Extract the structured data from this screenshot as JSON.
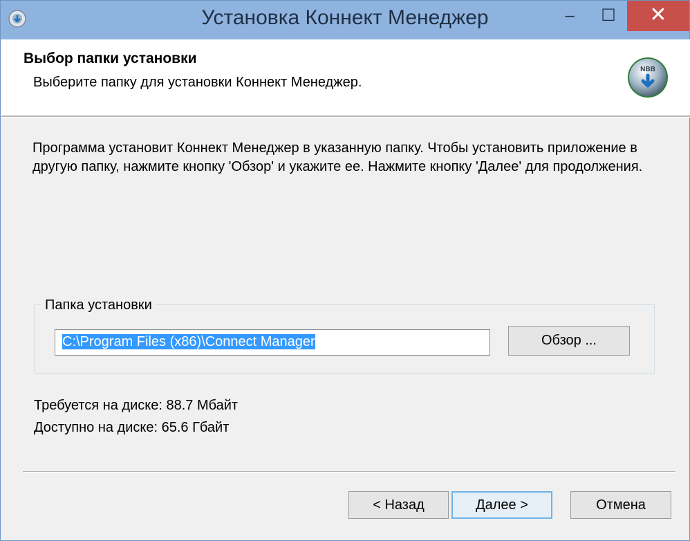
{
  "window": {
    "title": "Установка Коннект Менеджер",
    "minimize_glyph": "‒",
    "maximize_glyph": "☐",
    "close_glyph": "✕"
  },
  "header": {
    "title": "Выбор папки установки",
    "subtitle": "Выберите папку для установки Коннект Менеджер.",
    "logo_text": "NBB"
  },
  "description": "Программа установит Коннект Менеджер в указанную папку. Чтобы установить приложение в другую папку, нажмите кнопку 'Обзор' и укажите ее. Нажмите кнопку 'Далее' для продолжения.",
  "folder": {
    "group_label": "Папка установки",
    "path": "C:\\Program Files (x86)\\Connect Manager",
    "browse_label": "Обзор ..."
  },
  "disk": {
    "required": "Требуется на диске: 88.7 Мбайт",
    "available": "Доступно на диске: 65.6 Гбайт"
  },
  "buttons": {
    "back": "< Назад",
    "next": "Далее >",
    "cancel": "Отмена"
  },
  "colors": {
    "titlebar": "#8fb3df",
    "close_button": "#c7504b",
    "selection": "#3399ff"
  }
}
